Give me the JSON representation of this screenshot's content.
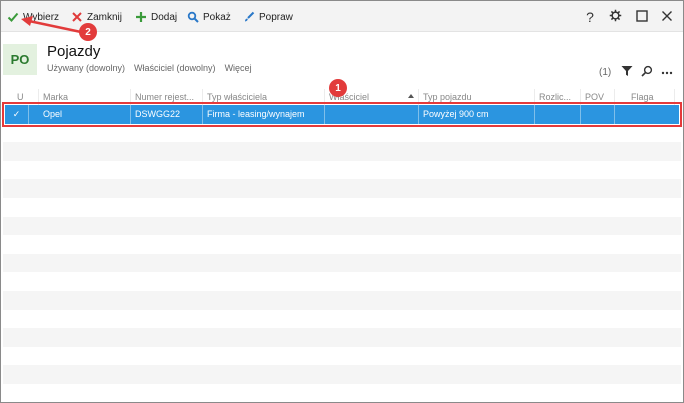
{
  "toolbar": {
    "select_label": "Wybierz",
    "close_label": "Zamknij",
    "add_label": "Dodaj",
    "show_label": "Pokaż",
    "edit_label": "Popraw",
    "help_label": "?"
  },
  "header": {
    "module_code": "PO",
    "title": "Pojazdy",
    "filters": [
      "Używany (dowolny)",
      "Właściciel (dowolny)",
      "Więcej"
    ],
    "filter_count": "(1)"
  },
  "grid": {
    "columns": [
      "U",
      "Marka",
      "Numer rejest...",
      "Typ właściciela",
      "Właściciel",
      "Typ pojazdu",
      "Rozlic...",
      "POV",
      "Flaga"
    ],
    "rows": [
      {
        "checked": "✓",
        "marka": "Opel",
        "numer": "DSWGG22",
        "typ_wlasciciela": "Firma - leasing/wynajem",
        "wlasciciel": "",
        "typ_pojazdu": "Powyżej 900 cm",
        "rozlic": "",
        "pov": "",
        "flaga": ""
      }
    ]
  },
  "annotations": [
    {
      "number": "1"
    },
    {
      "number": "2"
    }
  ],
  "colors": {
    "selection": "#2b95e0",
    "highlight": "#e53a3a",
    "module_tile_bg": "#e3f1df",
    "module_tile_text": "#2b7a2f"
  }
}
